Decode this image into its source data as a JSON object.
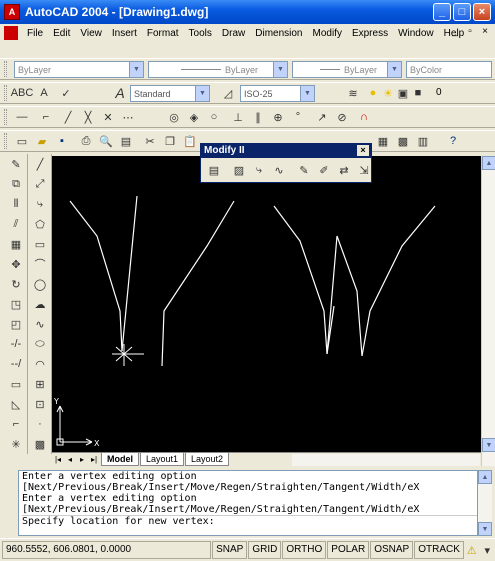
{
  "window": {
    "title": "AutoCAD 2004 - [Drawing1.dwg]",
    "app_icon": "autocad-icon"
  },
  "menu": [
    "File",
    "Edit",
    "View",
    "Insert",
    "Format",
    "Tools",
    "Draw",
    "Dimension",
    "Modify",
    "Express",
    "Window",
    "Help"
  ],
  "properties": {
    "layer": "ByLayer",
    "color_combo": "ByLayer",
    "linetype": "ByLayer",
    "lineweight": "ByColor",
    "layer_value": "0"
  },
  "styles": {
    "text_style": "Standard",
    "dim_style": "ISO-25"
  },
  "float_toolbar": {
    "title": "Modify II"
  },
  "tabs": [
    "Model",
    "Layout1",
    "Layout2"
  ],
  "ucs": {
    "x": "X",
    "y": "Y"
  },
  "command_lines": [
    "Enter a vertex editing option",
    "[Next/Previous/Break/Insert/Move/Regen/Straighten/Tangent/Width/eX",
    "Enter a vertex editing option",
    "[Next/Previous/Break/Insert/Move/Regen/Straighten/Tangent/Width/eX",
    "Specify location for new vertex:"
  ],
  "status": {
    "coords": "960.5552, 606.0801, 0.0000",
    "buttons": [
      "SNAP",
      "GRID",
      "ORTHO",
      "POLAR",
      "OSNAP",
      "OTRACK"
    ]
  }
}
